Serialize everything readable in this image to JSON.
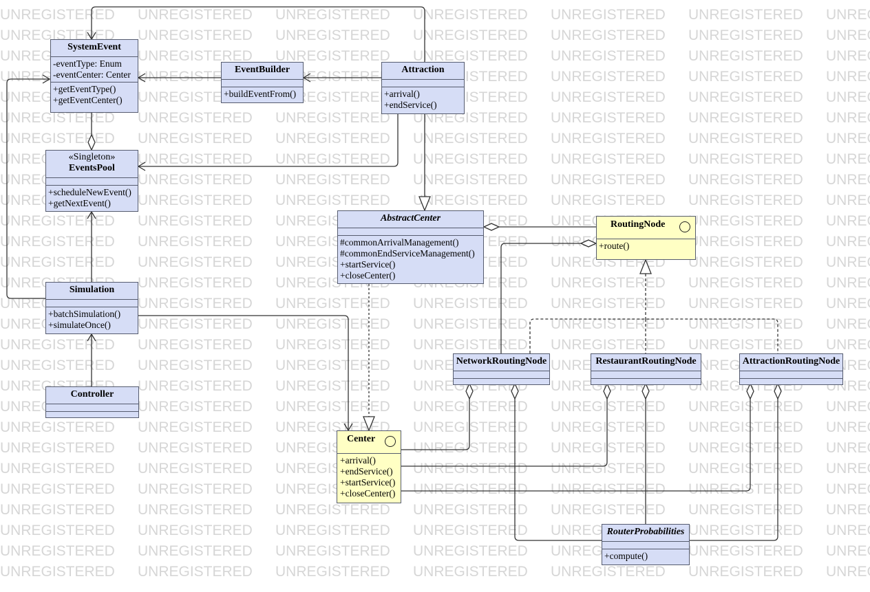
{
  "watermark": "UNREGISTERED",
  "classes": {
    "system_event": {
      "name": "SystemEvent",
      "attributes": [
        "-eventType: Enum",
        "-eventCenter: Center"
      ],
      "operations": [
        "+getEventType()",
        "+getEventCenter()"
      ]
    },
    "event_builder": {
      "name": "EventBuilder",
      "attributes": [],
      "operations": [
        "+buildEventFrom()"
      ]
    },
    "attraction": {
      "name": "Attraction",
      "attributes": [],
      "operations": [
        "+arrival()",
        "+endService()"
      ]
    },
    "events_pool": {
      "stereotype": "«Singleton»",
      "name": "EventsPool",
      "attributes": [],
      "operations": [
        "+scheduleNewEvent()",
        "+getNextEvent()"
      ]
    },
    "abstract_center": {
      "name": "AbstractCenter",
      "attributes": [],
      "operations": [
        "#commonArrivalManagement()",
        "#commonEndServiceManagement()",
        "+startService()",
        "+closeCenter()"
      ]
    },
    "routing_node": {
      "name": "RoutingNode",
      "operations": [
        "+route()"
      ]
    },
    "simulation": {
      "name": "Simulation",
      "attributes": [],
      "operations": [
        "+batchSimulation()",
        "+simulateOnce()"
      ]
    },
    "controller": {
      "name": "Controller",
      "attributes": [],
      "operations": []
    },
    "network_routing_node": {
      "name": "NetworkRoutingNode",
      "attributes": [],
      "operations": []
    },
    "restaurant_routing_node": {
      "name": "RestaurantRoutingNode",
      "attributes": [],
      "operations": []
    },
    "attraction_routing_node": {
      "name": "AttractionRoutingNode",
      "attributes": [],
      "operations": []
    },
    "center": {
      "name": "Center",
      "operations": [
        "+arrival()",
        "+endService()",
        "+startService()",
        "+closeCenter()"
      ]
    },
    "router_probabilities": {
      "name": "RouterProbabilities",
      "attributes": [],
      "operations": [
        "+compute()"
      ]
    }
  },
  "colors": {
    "class_fill": "#d6ddf6",
    "interface_fill": "#ffffc4",
    "border": "#555b6e",
    "line": "#333333",
    "watermark": "#d6d6d6"
  }
}
